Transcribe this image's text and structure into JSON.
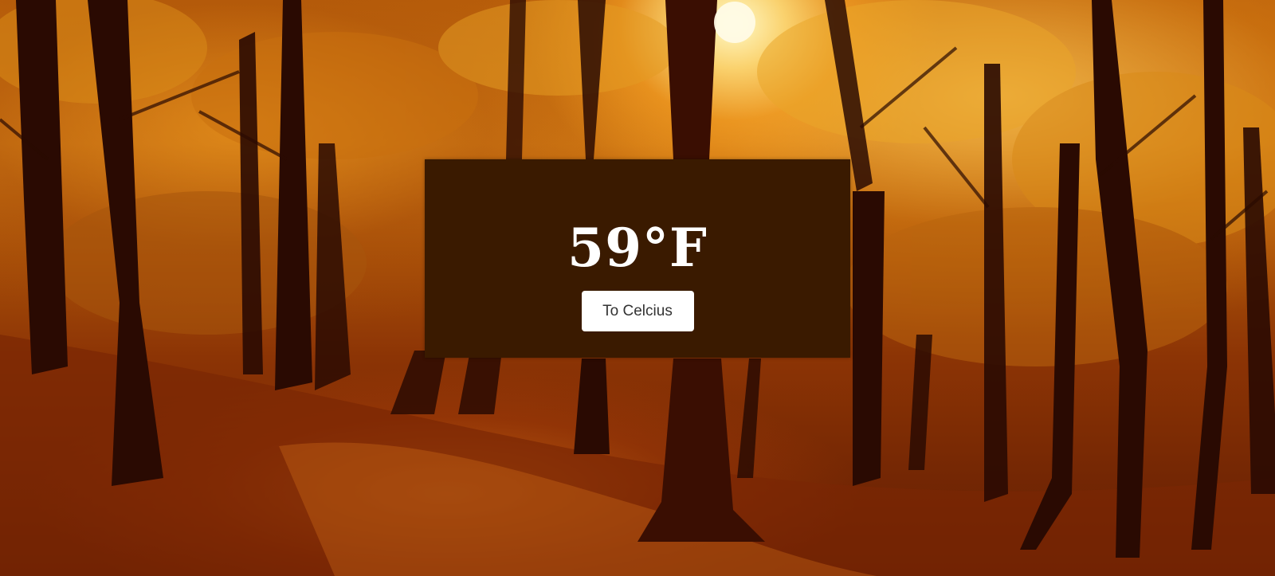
{
  "weather": {
    "temperature_value": "59",
    "temperature_unit": "°F",
    "toggle_label": "To Celcius"
  },
  "colors": {
    "card_background": "#3a1a00",
    "button_background": "#ffffff",
    "temperature_text": "#ffffff",
    "button_text": "#333333"
  },
  "background": {
    "scene": "autumn-forest-photo"
  }
}
